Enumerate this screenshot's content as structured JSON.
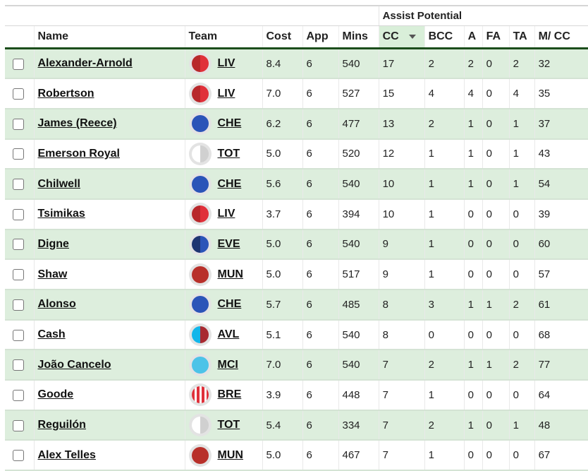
{
  "table": {
    "group_header": "Assist Potential",
    "columns": {
      "name": "Name",
      "team": "Team",
      "cost": "Cost",
      "app": "App",
      "mins": "Mins",
      "cc": "CC",
      "bcc": "BCC",
      "a": "A",
      "fa": "FA",
      "ta": "TA",
      "mcc": "M/ CC"
    },
    "sorted_column": "CC",
    "sort_direction": "descending",
    "rows": [
      {
        "name": "Alexander-Arnold",
        "team": "LIV",
        "kit": "liv",
        "cost": "8.4",
        "app": "6",
        "mins": "540",
        "cc": "17",
        "bcc": "2",
        "a": "2",
        "fa": "0",
        "ta": "2",
        "mcc": "32"
      },
      {
        "name": "Robertson",
        "team": "LIV",
        "kit": "liv",
        "cost": "7.0",
        "app": "6",
        "mins": "527",
        "cc": "15",
        "bcc": "4",
        "a": "4",
        "fa": "0",
        "ta": "4",
        "mcc": "35"
      },
      {
        "name": "James (Reece)",
        "team": "CHE",
        "kit": "che",
        "cost": "6.2",
        "app": "6",
        "mins": "477",
        "cc": "13",
        "bcc": "2",
        "a": "1",
        "fa": "0",
        "ta": "1",
        "mcc": "37"
      },
      {
        "name": "Emerson Royal",
        "team": "TOT",
        "kit": "tot",
        "cost": "5.0",
        "app": "6",
        "mins": "520",
        "cc": "12",
        "bcc": "1",
        "a": "1",
        "fa": "0",
        "ta": "1",
        "mcc": "43"
      },
      {
        "name": "Chilwell",
        "team": "CHE",
        "kit": "che",
        "cost": "5.6",
        "app": "6",
        "mins": "540",
        "cc": "10",
        "bcc": "1",
        "a": "1",
        "fa": "0",
        "ta": "1",
        "mcc": "54"
      },
      {
        "name": "Tsimikas",
        "team": "LIV",
        "kit": "liv",
        "cost": "3.7",
        "app": "6",
        "mins": "394",
        "cc": "10",
        "bcc": "1",
        "a": "0",
        "fa": "0",
        "ta": "0",
        "mcc": "39"
      },
      {
        "name": "Digne",
        "team": "EVE",
        "kit": "eve",
        "cost": "5.0",
        "app": "6",
        "mins": "540",
        "cc": "9",
        "bcc": "1",
        "a": "0",
        "fa": "0",
        "ta": "0",
        "mcc": "60"
      },
      {
        "name": "Shaw",
        "team": "MUN",
        "kit": "mun",
        "cost": "5.0",
        "app": "6",
        "mins": "517",
        "cc": "9",
        "bcc": "1",
        "a": "0",
        "fa": "0",
        "ta": "0",
        "mcc": "57"
      },
      {
        "name": "Alonso",
        "team": "CHE",
        "kit": "che",
        "cost": "5.7",
        "app": "6",
        "mins": "485",
        "cc": "8",
        "bcc": "3",
        "a": "1",
        "fa": "1",
        "ta": "2",
        "mcc": "61"
      },
      {
        "name": "Cash",
        "team": "AVL",
        "kit": "avl",
        "cost": "5.1",
        "app": "6",
        "mins": "540",
        "cc": "8",
        "bcc": "0",
        "a": "0",
        "fa": "0",
        "ta": "0",
        "mcc": "68"
      },
      {
        "name": "João Cancelo",
        "team": "MCI",
        "kit": "mci",
        "cost": "7.0",
        "app": "6",
        "mins": "540",
        "cc": "7",
        "bcc": "2",
        "a": "1",
        "fa": "1",
        "ta": "2",
        "mcc": "77"
      },
      {
        "name": "Goode",
        "team": "BRE",
        "kit": "bre",
        "cost": "3.9",
        "app": "6",
        "mins": "448",
        "cc": "7",
        "bcc": "1",
        "a": "0",
        "fa": "0",
        "ta": "0",
        "mcc": "64"
      },
      {
        "name": "Reguilón",
        "team": "TOT",
        "kit": "tot",
        "cost": "5.4",
        "app": "6",
        "mins": "334",
        "cc": "7",
        "bcc": "2",
        "a": "1",
        "fa": "0",
        "ta": "1",
        "mcc": "48"
      },
      {
        "name": "Alex Telles",
        "team": "MUN",
        "kit": "mun",
        "cost": "5.0",
        "app": "6",
        "mins": "467",
        "cc": "7",
        "bcc": "1",
        "a": "0",
        "fa": "0",
        "ta": "0",
        "mcc": "67"
      }
    ]
  },
  "kit_colors": {
    "liv": {
      "style": "split",
      "left": "#b8282b",
      "right": "#e0303a"
    },
    "che": {
      "style": "solid",
      "color": "#2b54b8"
    },
    "tot": {
      "style": "split",
      "left": "#ffffff",
      "right": "#d0d0d0"
    },
    "eve": {
      "style": "split",
      "left": "#1e3572",
      "right": "#2b54b8"
    },
    "mun": {
      "style": "solid",
      "color": "#b8302a"
    },
    "avl": {
      "style": "split",
      "left": "#12b6ea",
      "right": "#a82a30"
    },
    "mci": {
      "style": "solid",
      "color": "#4cc3e8"
    },
    "bre": {
      "style": "stripes",
      "a": "#e0303a",
      "b": "#ffffff"
    }
  },
  "colors": {
    "row_alt": "#ddeedd",
    "sorted_header": "#d9efd9",
    "header_rule": "#1b4d1b"
  }
}
